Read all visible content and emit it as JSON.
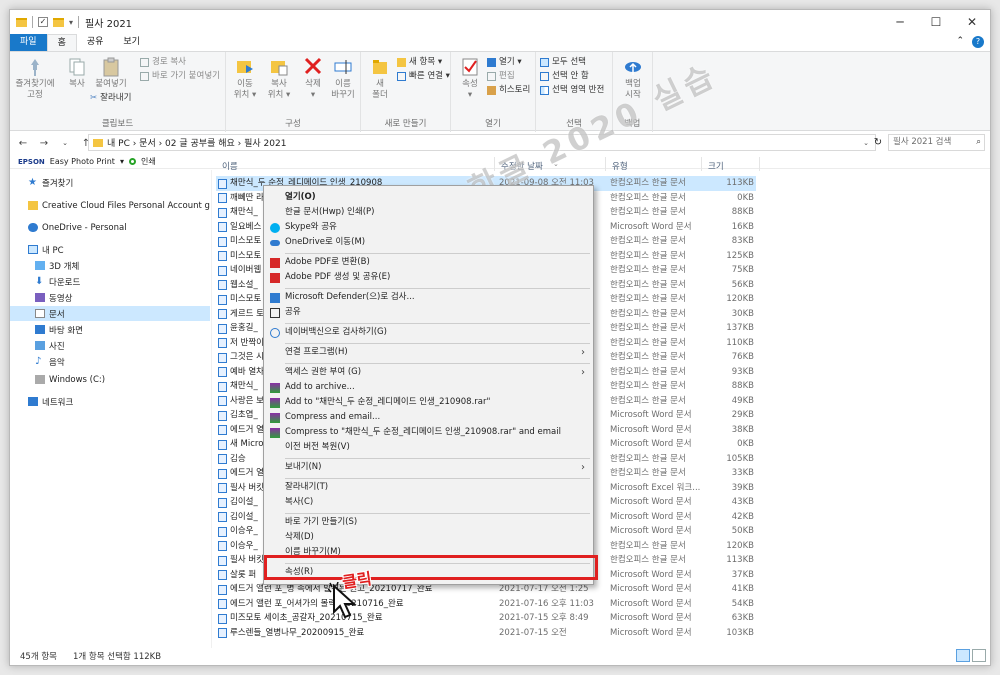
{
  "window": {
    "title": "필사 2021"
  },
  "tabs": [
    "파일",
    "홈",
    "공유",
    "보기"
  ],
  "ribbon": {
    "clipboard": {
      "pin_label_1": "즐겨찾기에",
      "pin_label_2": "고정",
      "copy": "복사",
      "paste": "붙여넣기",
      "copy_path": "경로 복사",
      "paste_shortcut": "바로 가기 붙여넣기",
      "cut": "잘라내기",
      "group": "클립보드"
    },
    "organize": {
      "move_1": "이동",
      "move_2": "위치 ▾",
      "copyto_1": "복사",
      "copyto_2": "위치 ▾",
      "delete_1": "삭제",
      "delete_2": "▾",
      "rename_1": "이름",
      "rename_2": "바꾸기",
      "group": "구성"
    },
    "new": {
      "newfolder_1": "새",
      "newfolder_2": "폴더",
      "new_item": "새 항목 ▾",
      "easy_access": "빠른 연결 ▾",
      "group": "새로 만들기"
    },
    "open": {
      "properties_1": "속성",
      "properties_2": "▾",
      "open": "열기 ▾",
      "edit": "편집",
      "history": "히스토리",
      "group": "열기"
    },
    "select": {
      "select_all": "모두 선택",
      "select_none": "선택 안 함",
      "invert": "선택 영역 반전",
      "group": "선택"
    },
    "backup": {
      "label_1": "백업",
      "label_2": "시작",
      "group": "백업"
    }
  },
  "address": {
    "path": "내 PC  ›  문서  ›  02 글 공부를 해요  ›  필사 2021",
    "search_placeholder": "필사 2021 검색"
  },
  "epson": {
    "brand": "EPSON",
    "app": "Easy Photo Print",
    "print": "인쇄"
  },
  "nav": {
    "items": [
      "즐겨찾기",
      "Creative Cloud Files Personal Account giznot",
      "OneDrive - Personal",
      "내 PC",
      "3D 개체",
      "다운로드",
      "동영상",
      "문서",
      "바탕 화면",
      "사진",
      "음악",
      "Windows (C:)",
      "네트워크"
    ]
  },
  "columns": {
    "name": "이름",
    "date": "수정한 날짜",
    "type": "유형",
    "size": "크기"
  },
  "files": [
    {
      "name": "채만식_두 순정_레디메이드 인생_210908",
      "date": "2021-09-08 오전 11:03",
      "type": "한컴오피스 한글 문서",
      "size": "113KB"
    },
    {
      "name": "깨뻬딴 라",
      "date": "",
      "type": "한컴오피스 한글 문서",
      "size": "0KB"
    },
    {
      "name": "채만식_",
      "date": "",
      "type": "한컴오피스 한글 문서",
      "size": "88KB"
    },
    {
      "name": "일요베스",
      "date": "",
      "type": "Microsoft Word 문서",
      "size": "16KB"
    },
    {
      "name": "미스모토",
      "date": "",
      "type": "한컴오피스 한글 문서",
      "size": "83KB"
    },
    {
      "name": "미스모토",
      "date": "",
      "type": "한컴오피스 한글 문서",
      "size": "125KB"
    },
    {
      "name": "네이버웹",
      "date": "",
      "type": "한컴오피스 한글 문서",
      "size": "75KB"
    },
    {
      "name": "웹소설_",
      "date": "",
      "type": "한컴오피스 한글 문서",
      "size": "56KB"
    },
    {
      "name": "미스모토",
      "date": "",
      "type": "한컴오피스 한글 문서",
      "size": "120KB"
    },
    {
      "name": "게르드 토",
      "date": "",
      "type": "한컴오피스 한글 문서",
      "size": "30KB"
    },
    {
      "name": "윤홍길_",
      "date": "",
      "type": "한컴오피스 한글 문서",
      "size": "137KB"
    },
    {
      "name": "저 반짝이",
      "date": "",
      "type": "한컴오피스 한글 문서",
      "size": "110KB"
    },
    {
      "name": "그것은 시",
      "date": "",
      "type": "한컴오피스 한글 문서",
      "size": "76KB"
    },
    {
      "name": "예바 열차",
      "date": "",
      "type": "한컴오피스 한글 문서",
      "size": "93KB"
    },
    {
      "name": "채만식_",
      "date": "",
      "type": "한컴오피스 한글 문서",
      "size": "88KB"
    },
    {
      "name": "사랑은 보",
      "date": "",
      "type": "한컴오피스 한글 문서",
      "size": "49KB"
    },
    {
      "name": "김초엽_",
      "date": "",
      "type": "Microsoft Word 문서",
      "size": "29KB"
    },
    {
      "name": "에드거 열",
      "date": "",
      "type": "Microsoft Word 문서",
      "size": "38KB"
    },
    {
      "name": "새 Micro",
      "date": "",
      "type": "Microsoft Word 문서",
      "size": "0KB"
    },
    {
      "name": "김승",
      "date": "",
      "type": "한컴오피스 한글 문서",
      "size": "105KB"
    },
    {
      "name": "에드거 열",
      "date": "",
      "type": "한컴오피스 한글 문서",
      "size": "33KB"
    },
    {
      "name": "필사 버킷",
      "date": "",
      "type": "Microsoft Excel 워크...",
      "size": "39KB"
    },
    {
      "name": "김이설_",
      "date": "",
      "type": "Microsoft Word 문서",
      "size": "43KB"
    },
    {
      "name": "김이설_",
      "date": "",
      "type": "Microsoft Word 문서",
      "size": "42KB"
    },
    {
      "name": "이승우_",
      "date": "",
      "type": "Microsoft Word 문서",
      "size": "50KB"
    },
    {
      "name": "이승우_",
      "date": "",
      "type": "한컴오피스 한글 문서",
      "size": "120KB"
    },
    {
      "name": "필사 버킷",
      "date": "",
      "type": "한컴오피스 한글 문서",
      "size": "113KB"
    },
    {
      "name": "살롯 퍼",
      "date": "",
      "type": "Microsoft Word 문서",
      "size": "37KB"
    },
    {
      "name": "에드거 앨런 포_병 속에서 발견된 원고_20210717_완료",
      "date": "2021-07-17 오전 1:25",
      "type": "Microsoft Word 문서",
      "size": "41KB"
    },
    {
      "name": "에드거 앨런 포_어셔가의 몰락_20210716_완료",
      "date": "2021-07-16 오후 11:03",
      "type": "Microsoft Word 문서",
      "size": "54KB"
    },
    {
      "name": "미즈모토 세이초_공갈자_20210715_완료",
      "date": "2021-07-15 오후 8:49",
      "type": "Microsoft Word 문서",
      "size": "63KB"
    },
    {
      "name": "루스렌들_열병나무_20200915_완료",
      "date": "2021-07-15 오전 ",
      "type": "Microsoft Word 문서",
      "size": "103KB"
    }
  ],
  "context_menu": {
    "open": "열기(O)",
    "print": "한글 문서(Hwp) 인쇄(P)",
    "skype": "Skype와 공유",
    "onedrive": "OneDrive로 이동(M)",
    "pdf_convert": "Adobe PDF로 변환(B)",
    "pdf_share": "Adobe PDF 생성 및 공유(E)",
    "defender": "Microsoft Defender(으)로 검사...",
    "share": "공유",
    "naver": "네이버백신으로 검사하기(G)",
    "open_with": "연결 프로그램(H)",
    "access": "액세스 권한 부여 (G)",
    "archive": "Add to archive...",
    "add_rar": "Add to \"채만식_두 순정_레디메이드 인생_210908.rar\"",
    "compress_email": "Compress and email...",
    "compress_rar_email": "Compress to \"채만식_두 순정_레디메이드 인생_210908.rar\" and email",
    "restore": "이전 버전 복원(V)",
    "send_to": "보내기(N)",
    "cut": "잘라내기(T)",
    "copy": "복사(C)",
    "shortcut": "바로 가기 만들기(S)",
    "delete": "삭제(D)",
    "rename": "이름 바꾸기(M)",
    "properties": "속성(R)"
  },
  "annotation": {
    "click": "클릭",
    "watermark": "갈랭의 한글 2020 실습"
  },
  "status": {
    "count": "45개 항목",
    "selected": "1개 항목 선택함 112KB"
  },
  "colors": {
    "accent": "#1979ca",
    "selection": "#cce8ff",
    "highlight_red": "#e02020"
  }
}
